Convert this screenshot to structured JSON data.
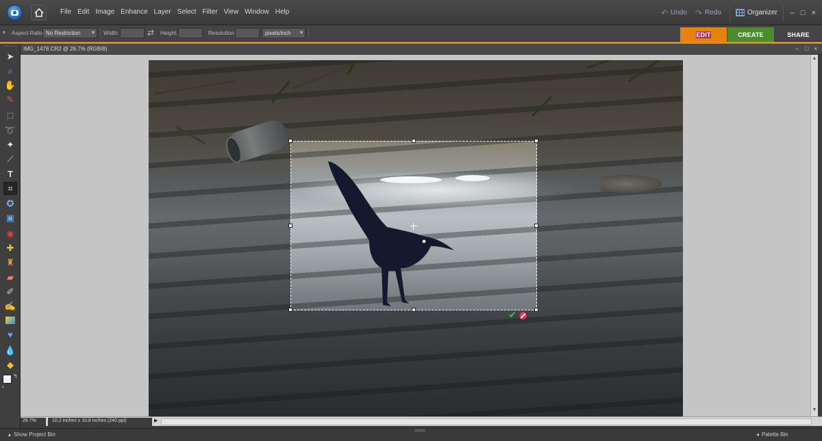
{
  "menubar": {
    "menu_items": [
      "File",
      "Edit",
      "Image",
      "Enhance",
      "Layer",
      "Select",
      "Filter",
      "View",
      "Window",
      "Help"
    ],
    "undo_label": "Undo",
    "redo_label": "Redo",
    "organizer_label": "Organizer",
    "window_controls": [
      "–",
      "□",
      "×"
    ]
  },
  "options": {
    "aspect_label": "Aspect Ratio:",
    "aspect_value": "No Restriction",
    "width_label": "Width:",
    "height_label": "Height:",
    "resolution_label": "Resolution:",
    "resolution_unit": "pixels/inch",
    "swap_icon": "swap-icon"
  },
  "mode_tabs": [
    {
      "label": "EDIT",
      "color": "#e6820f"
    },
    {
      "label": "CREATE",
      "color": "#a0305f"
    },
    {
      "label": "SHARE",
      "color": "#4c8a2e"
    }
  ],
  "document": {
    "title": "IMG_1478.CR2 @ 26.7% (RGB/8)",
    "zoom": "26.7%",
    "info": "10.2 inches x 10.8 inches (240 ppi)"
  },
  "bottombar": {
    "project_bin": "Show Project Bin",
    "palette_bin": "Palette Bin"
  },
  "tools": [
    "move-tool-icon",
    "zoom-tool-icon",
    "hand-tool-icon",
    "eyedropper-tool-icon",
    "marquee-tool-icon",
    "lasso-tool-icon",
    "magic-wand-tool-icon",
    "selection-brush-tool-icon",
    "type-tool-icon",
    "crop-tool-icon",
    "cookie-cutter-tool-icon",
    "straighten-tool-icon",
    "red-eye-tool-icon",
    "healing-brush-tool-icon",
    "clone-stamp-tool-icon",
    "eraser-tool-icon",
    "brush-tool-icon",
    "smart-brush-tool-icon",
    "gradient-tool-icon",
    "shape-tool-icon",
    "blur-tool-icon",
    "sponge-tool-icon"
  ],
  "colors": {
    "accent_orange": "#e68a16",
    "canvas_bg": "#c5c5c5"
  }
}
